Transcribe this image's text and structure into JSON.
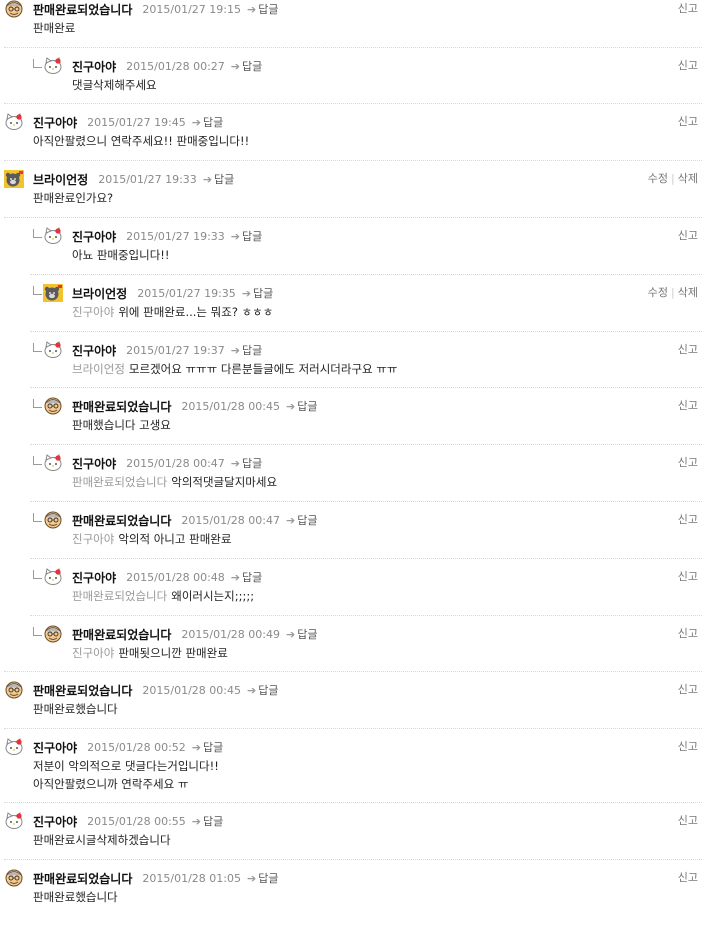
{
  "report_label": "신고",
  "edit_label": "수정",
  "delete_label": "삭제",
  "reply_label": "답글",
  "comments": [
    {
      "nick": "판매완료되었습니다",
      "time": "2015/01/27 19:15",
      "avatar": "grandpa",
      "lines": [
        "판매완료"
      ],
      "mention": "",
      "reply": false,
      "own": false
    },
    {
      "nick": "진구아야",
      "time": "2015/01/28 00:27",
      "avatar": "kitty",
      "lines": [
        "댓글삭제해주세요"
      ],
      "mention": "",
      "reply": true,
      "own": false
    },
    {
      "nick": "진구아야",
      "time": "2015/01/27 19:45",
      "avatar": "kitty",
      "lines": [
        "아직안팔렸으니 연락주세요!! 판매중입니다!!"
      ],
      "mention": "",
      "reply": false,
      "own": false
    },
    {
      "nick": "브라이언정",
      "time": "2015/01/27 19:33",
      "avatar": "bear",
      "lines": [
        "판매완료인가요?"
      ],
      "mention": "",
      "reply": false,
      "own": true
    },
    {
      "nick": "진구아야",
      "time": "2015/01/27 19:33",
      "avatar": "kitty",
      "lines": [
        "아뇨 판매중입니다!!"
      ],
      "mention": "",
      "reply": true,
      "own": false
    },
    {
      "nick": "브라이언정",
      "time": "2015/01/27 19:35",
      "avatar": "bear",
      "lines": [
        "위에 판매완료...는 뭐죠? ㅎㅎㅎ"
      ],
      "mention": "진구아야",
      "reply": true,
      "own": true
    },
    {
      "nick": "진구아야",
      "time": "2015/01/27 19:37",
      "avatar": "kitty",
      "lines": [
        "모르겠어요 ㅠㅠㅠ 다른분들글에도 저러시더라구요 ㅠㅠ"
      ],
      "mention": "브라이언정",
      "reply": true,
      "own": false
    },
    {
      "nick": "판매완료되었습니다",
      "time": "2015/01/28 00:45",
      "avatar": "grandpa",
      "lines": [
        "판매했습니다 고생요"
      ],
      "mention": "",
      "reply": true,
      "own": false
    },
    {
      "nick": "진구아야",
      "time": "2015/01/28 00:47",
      "avatar": "kitty",
      "lines": [
        "악의적댓글달지마세요"
      ],
      "mention": "판매완료되었습니다",
      "reply": true,
      "own": false
    },
    {
      "nick": "판매완료되었습니다",
      "time": "2015/01/28 00:47",
      "avatar": "grandpa",
      "lines": [
        "악의적 아니고 판매완료"
      ],
      "mention": "진구아야",
      "reply": true,
      "own": false
    },
    {
      "nick": "진구아야",
      "time": "2015/01/28 00:48",
      "avatar": "kitty",
      "lines": [
        "왜이러시는지;;;;;"
      ],
      "mention": "판매완료되었습니다",
      "reply": true,
      "own": false
    },
    {
      "nick": "판매완료되었습니다",
      "time": "2015/01/28 00:49",
      "avatar": "grandpa",
      "lines": [
        "판매됫으니깐 판매완료"
      ],
      "mention": "진구아야",
      "reply": true,
      "own": false
    },
    {
      "nick": "판매완료되었습니다",
      "time": "2015/01/28 00:45",
      "avatar": "grandpa",
      "lines": [
        "판매완료했습니다"
      ],
      "mention": "",
      "reply": false,
      "own": false
    },
    {
      "nick": "진구아야",
      "time": "2015/01/28 00:52",
      "avatar": "kitty",
      "lines": [
        "저분이 악의적으로 댓글다는거입니다!!",
        "아직안팔렸으니까 연락주세요 ㅠ"
      ],
      "mention": "",
      "reply": false,
      "own": false
    },
    {
      "nick": "진구아야",
      "time": "2015/01/28 00:55",
      "avatar": "kitty",
      "lines": [
        "판매완료시글삭제하겠습니다"
      ],
      "mention": "",
      "reply": false,
      "own": false
    },
    {
      "nick": "판매완료되었습니다",
      "time": "2015/01/28 01:05",
      "avatar": "grandpa",
      "lines": [
        "판매완료했습니다"
      ],
      "mention": "",
      "reply": false,
      "own": false
    }
  ]
}
